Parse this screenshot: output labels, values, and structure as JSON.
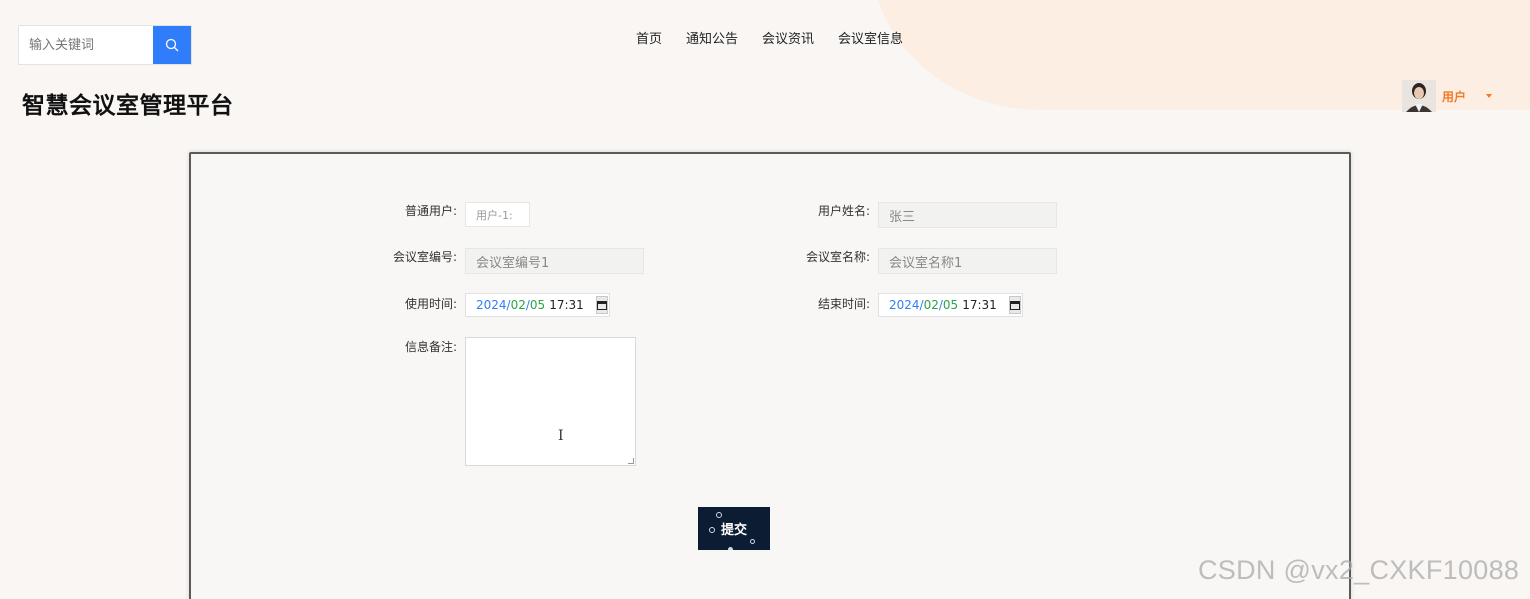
{
  "search": {
    "placeholder": "输入关键词"
  },
  "nav": [
    "首页",
    "通知公告",
    "会议资讯",
    "会议室信息"
  ],
  "site_title": "智慧会议室管理平台",
  "user": {
    "name": "用户"
  },
  "form": {
    "normal_user_label": "普通用户:",
    "normal_user_value": "用户-1:",
    "user_name_label": "用户姓名:",
    "user_name_value": "张三",
    "room_no_label": "会议室编号:",
    "room_no_value": "会议室编号1",
    "room_name_label": "会议室名称:",
    "room_name_value": "会议室名称1",
    "start_time_label": "使用时间:",
    "end_time_label": "结束时间:",
    "start": {
      "year": "2024",
      "month": "02",
      "day": "05",
      "time": "17:31"
    },
    "end": {
      "year": "2024",
      "month": "02",
      "day": "05",
      "time": "17:31"
    },
    "remark_label": "信息备注:",
    "submit_label": "提交"
  },
  "watermark": "CSDN @vx2_CXKF10088",
  "colors": {
    "accent_blue": "#2f7dfa",
    "user_orange": "#f07b2a",
    "submit_bg": "#0c1c33",
    "blob": "#fdeee3"
  }
}
